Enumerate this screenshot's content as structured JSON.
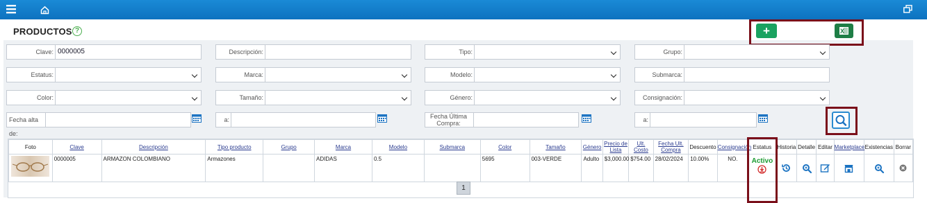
{
  "page": {
    "title": "PRODUCTOS"
  },
  "filters": {
    "clave": {
      "label": "Clave:",
      "value": "0000005"
    },
    "descripcion": {
      "label": "Descripción:",
      "value": ""
    },
    "tipo": {
      "label": "Tipo:",
      "value": ""
    },
    "grupo": {
      "label": "Grupo:",
      "value": ""
    },
    "estatus": {
      "label": "Estatus:",
      "value": ""
    },
    "marca": {
      "label": "Marca:",
      "value": ""
    },
    "modelo": {
      "label": "Modelo:",
      "value": ""
    },
    "submarca": {
      "label": "Submarca:",
      "value": ""
    },
    "color": {
      "label": "Color:",
      "value": ""
    },
    "tamano": {
      "label": "Tamaño:",
      "value": ""
    },
    "genero": {
      "label": "Género:",
      "value": ""
    },
    "consignacion": {
      "label": "Consignación:",
      "value": ""
    },
    "fecha_alta": {
      "label": "Fecha alta de:",
      "value": ""
    },
    "fecha_alta_a": {
      "label": "a:",
      "value": ""
    },
    "fecha_ultima_compra": {
      "label": "Fecha Última Compra:",
      "value": ""
    },
    "fecha_ultima_compra_a": {
      "label": "a:",
      "value": ""
    }
  },
  "table": {
    "headers": {
      "foto": "Foto",
      "clave": "Clave",
      "descripcion": "Descripción",
      "tipo": "Tipo producto",
      "grupo": "Grupo",
      "marca": "Marca",
      "modelo": "Modelo",
      "submarca": "Submarca",
      "color": "Color",
      "tamano": "Tamaño",
      "genero": "Género",
      "precio": "Precio de Lista",
      "ult_costo": "Ult. Costo",
      "fecha_ult": "Fecha Ult. Compra",
      "descuento": "Descuento",
      "consignacion": "Consignación",
      "estatus": "Estatus",
      "historia": "Historia",
      "detalle": "Detalle",
      "editar": "Editar",
      "marketplace": "Marketplace",
      "existencias": "Existencias",
      "borrar": "Borrar"
    },
    "rows": [
      {
        "clave": "0000005",
        "descripcion": "ARMAZON COLOMBIANO",
        "tipo": "Armazones",
        "grupo": "",
        "marca": "ADIDAS",
        "modelo": "0.5",
        "submarca": "",
        "color": "5695",
        "tamano": "003-VERDE",
        "genero": "Adulto",
        "precio": "$3,000.00",
        "ult_costo": "$754.00",
        "fecha_ult": "28/02/2024",
        "descuento": "10.00%",
        "consignacion": "NO.",
        "estatus": "Activo"
      }
    ]
  },
  "pagination": {
    "current": "1"
  },
  "colors": {
    "topbar": "#1080cc",
    "highlight": "#7a0f1a",
    "add_button": "#1aa260",
    "excel_button": "#1e7e46",
    "active": "#1a9a30",
    "link": "#2a3b8f"
  },
  "icons": [
    "menu-icon",
    "home-icon",
    "restore-window-icon",
    "help-icon",
    "add-icon",
    "excel-icon",
    "calendar-icon",
    "search-icon",
    "download-icon",
    "history-icon",
    "detail-icon",
    "edit-icon",
    "marketplace-icon",
    "existencias-icon",
    "delete-icon"
  ]
}
